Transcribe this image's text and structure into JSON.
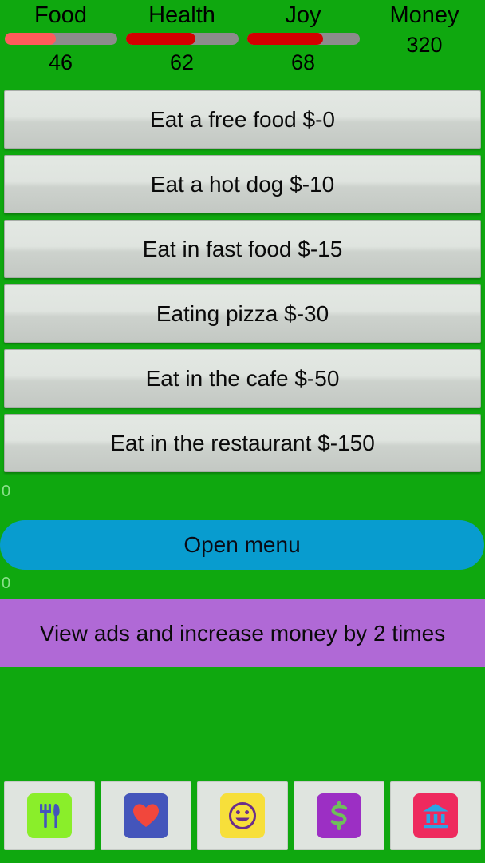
{
  "colors": {
    "background_green": "#0fa80f",
    "bar_track_gray": "#8c8c8c",
    "food_fill": "#ff5b5b",
    "health_fill": "#d40000",
    "joy_fill": "#d40000",
    "open_menu_blue": "#089ccf",
    "ad_banner_purple": "#b069d6",
    "button_face": "#dfe4df",
    "counter_text": "#8be08b"
  },
  "stats": [
    {
      "label": "Food",
      "value": "46",
      "percent": 46,
      "fill": "#ff5b5b",
      "has_bar": true
    },
    {
      "label": "Health",
      "value": "62",
      "percent": 62,
      "fill": "#d40000",
      "has_bar": true
    },
    {
      "label": "Joy",
      "value": "68",
      "percent": 68,
      "fill": "#d40000",
      "has_bar": true
    },
    {
      "label": "Money",
      "value": "320",
      "percent": 0,
      "fill": "",
      "has_bar": false
    }
  ],
  "actions": [
    {
      "label": "Eat a free food $-0"
    },
    {
      "label": "Eat a hot dog $-10"
    },
    {
      "label": "Eat in fast food $-15"
    },
    {
      "label": "Eating pizza $-30"
    },
    {
      "label": "Eat in the cafe $-50"
    },
    {
      "label": "Eat in the restaurant $-150"
    }
  ],
  "counters": {
    "top": "0",
    "bottom": "0"
  },
  "open_menu": {
    "label": "Open menu"
  },
  "ad_banner": {
    "label": "View ads and increase money by 2 times"
  },
  "bottom_nav": [
    {
      "name": "food",
      "icon": "fork-knife-icon",
      "tile_bg": "#8aee2a",
      "glyph_color": "#4455bb"
    },
    {
      "name": "health",
      "icon": "heart-icon",
      "tile_bg": "#4455bb",
      "glyph_color": "#f1473c"
    },
    {
      "name": "joy",
      "icon": "smiley-icon",
      "tile_bg": "#f7df3a",
      "glyph_color": "#6b2d8b"
    },
    {
      "name": "money",
      "icon": "dollar-icon",
      "tile_bg": "#9c2fc4",
      "glyph_color": "#6fbf5a"
    },
    {
      "name": "bank",
      "icon": "bank-icon",
      "tile_bg": "#ee2a5e",
      "glyph_color": "#2aa5e6"
    }
  ]
}
